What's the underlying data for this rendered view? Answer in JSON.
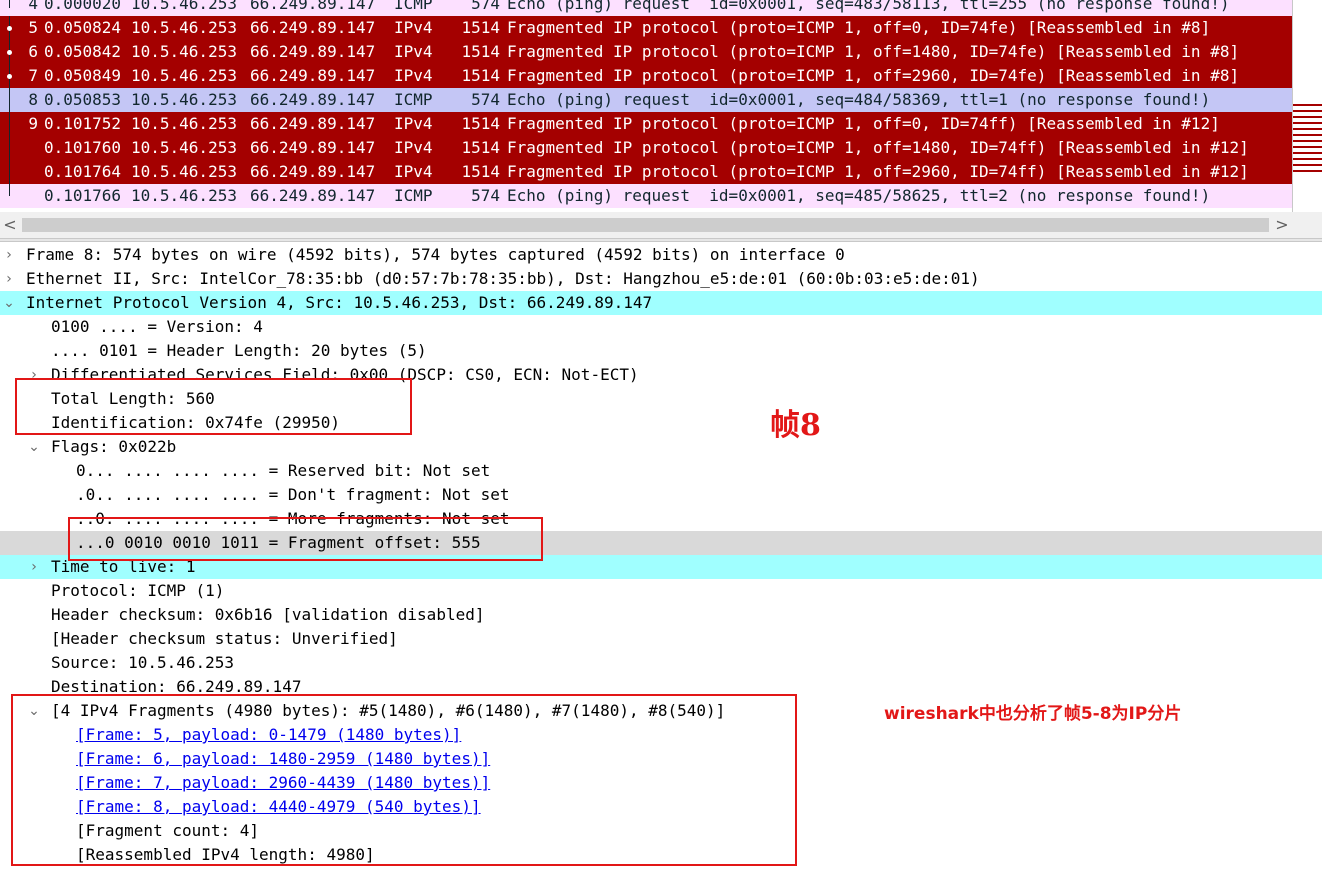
{
  "packet_list": {
    "rows": [
      {
        "no": "4",
        "time": "0.000020",
        "src": "10.5.46.253",
        "dst": "66.249.89.147",
        "proto": "ICMP",
        "len": "574",
        "info": "Echo (ping) request  id=0x0001, seq=483/58113, ttl=255 (no response found!)",
        "kind": "icmp"
      },
      {
        "no": "5",
        "time": "0.050824",
        "src": "10.5.46.253",
        "dst": "66.249.89.147",
        "proto": "IPv4",
        "len": "1514",
        "info": "Fragmented IP protocol (proto=ICMP 1, off=0, ID=74fe) [Reassembled in #8]",
        "kind": "frag"
      },
      {
        "no": "6",
        "time": "0.050842",
        "src": "10.5.46.253",
        "dst": "66.249.89.147",
        "proto": "IPv4",
        "len": "1514",
        "info": "Fragmented IP protocol (proto=ICMP 1, off=1480, ID=74fe) [Reassembled in #8]",
        "kind": "frag"
      },
      {
        "no": "7",
        "time": "0.050849",
        "src": "10.5.46.253",
        "dst": "66.249.89.147",
        "proto": "IPv4",
        "len": "1514",
        "info": "Fragmented IP protocol (proto=ICMP 1, off=2960, ID=74fe) [Reassembled in #8]",
        "kind": "frag"
      },
      {
        "no": "8",
        "time": "0.050853",
        "src": "10.5.46.253",
        "dst": "66.249.89.147",
        "proto": "ICMP",
        "len": "574",
        "info": "Echo (ping) request  id=0x0001, seq=484/58369, ttl=1 (no response found!)",
        "kind": "selected"
      },
      {
        "no": "9",
        "time": "0.101752",
        "src": "10.5.46.253",
        "dst": "66.249.89.147",
        "proto": "IPv4",
        "len": "1514",
        "info": "Fragmented IP protocol (proto=ICMP 1, off=0, ID=74ff) [Reassembled in #12]",
        "kind": "frag"
      },
      {
        "no": "",
        "time": "0.101760",
        "src": "10.5.46.253",
        "dst": "66.249.89.147",
        "proto": "IPv4",
        "len": "1514",
        "info": "Fragmented IP protocol (proto=ICMP 1, off=1480, ID=74ff) [Reassembled in #12]",
        "kind": "frag"
      },
      {
        "no": "",
        "time": "0.101764",
        "src": "10.5.46.253",
        "dst": "66.249.89.147",
        "proto": "IPv4",
        "len": "1514",
        "info": "Fragmented IP protocol (proto=ICMP 1, off=2960, ID=74ff) [Reassembled in #12]",
        "kind": "frag"
      },
      {
        "no": "",
        "time": "0.101766",
        "src": "10.5.46.253",
        "dst": "66.249.89.147",
        "proto": "ICMP",
        "len": "574",
        "info": "Echo (ping) request  id=0x0001, seq=485/58625, ttl=2 (no response found!)",
        "kind": "icmp"
      }
    ]
  },
  "scrollbar": {
    "left_arrow": "<",
    "right_arrow": ">"
  },
  "details": {
    "frame": "Frame 8: 574 bytes on wire (4592 bits), 574 bytes captured (4592 bits) on interface 0",
    "ethernet": "Ethernet II, Src: IntelCor_78:35:bb (d0:57:7b:78:35:bb), Dst: Hangzhou_e5:de:01 (60:0b:03:e5:de:01)",
    "ipv4": "Internet Protocol Version 4, Src: 10.5.46.253, Dst: 66.249.89.147",
    "version": "0100 .... = Version: 4",
    "header_length": ".... 0101 = Header Length: 20 bytes (5)",
    "dsfield": "Differentiated Services Field: 0x00 (DSCP: CS0, ECN: Not-ECT)",
    "total_length": "Total Length: 560",
    "identification": "Identification: 0x74fe (29950)",
    "flags": "Flags: 0x022b",
    "reserved_bit": "0... .... .... .... = Reserved bit: Not set",
    "dont_fragment": ".0.. .... .... .... = Don't fragment: Not set",
    "more_fragments": "..0. .... .... .... = More fragments: Not set",
    "fragment_offset": "...0 0010 0010 1011 = Fragment offset: 555",
    "ttl": "Time to live: 1",
    "protocol": "Protocol: ICMP (1)",
    "checksum": "Header checksum: 0x6b16 [validation disabled]",
    "checksum_status": "[Header checksum status: Unverified]",
    "source": "Source: 10.5.46.253",
    "destination": "Destination: 66.249.89.147",
    "fragments_header": "[4 IPv4 Fragments (4980 bytes): #5(1480), #6(1480), #7(1480), #8(540)]",
    "fragment_links": [
      "[Frame: 5, payload: 0-1479 (1480 bytes)]",
      "[Frame: 6, payload: 1480-2959 (1480 bytes)]",
      "[Frame: 7, payload: 2960-4439 (1480 bytes)]",
      "[Frame: 8, payload: 4440-4979 (540 bytes)]"
    ],
    "fragment_count": "[Fragment count: 4]",
    "reassembled_length": "[Reassembled IPv4 length: 4980]"
  },
  "annotations": {
    "frame_label": "帧8",
    "note": "wireshark中也分析了帧5-8为IP分片"
  },
  "icons": {
    "collapsed": "chevron-right-icon",
    "expanded": "chevron-down-icon"
  },
  "colors": {
    "fragment_row": "#a40000",
    "icmp_row": "#fce0ff",
    "selected_row": "#c4c6f5",
    "highlight_cyan": "#a0ffff",
    "annotation_red": "#e21717"
  }
}
